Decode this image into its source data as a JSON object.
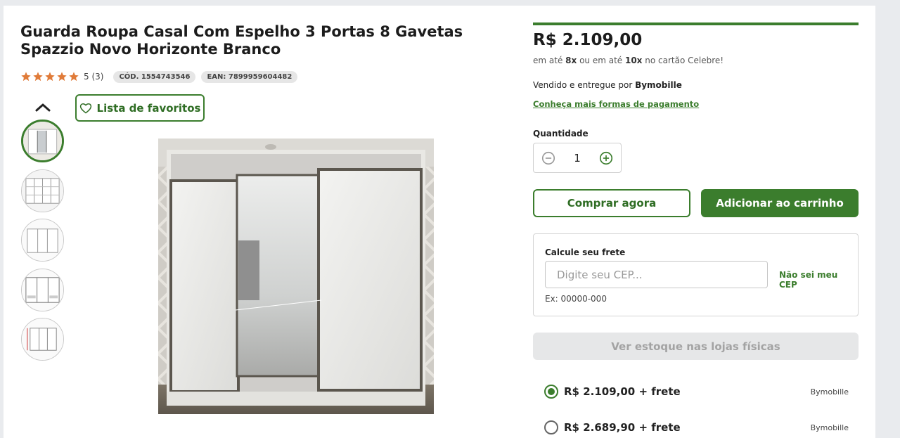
{
  "product": {
    "title": "Guarda Roupa Casal Com Espelho 3 Portas 8 Gavetas Spazzio Novo Horizonte Branco",
    "rating_text": "5 (3)",
    "rating_stars": 5,
    "code": "CÓD. 1554743546",
    "ean": "EAN: 7899959604482"
  },
  "gallery": {
    "favorites_label": "Lista de favoritos",
    "thumbnails": [
      "Foto 1",
      "Foto 2",
      "Foto 3",
      "Foto 4",
      "Foto 5"
    ],
    "selected_index": 0
  },
  "purchase": {
    "price": "R$ 2.109,00",
    "install_pre": "em até ",
    "install_n1": "8x",
    "install_mid": " ou em até ",
    "install_n2": "10x",
    "install_post": " no cartão Celebre!",
    "seller_pre": "Vendido e entregue por ",
    "seller_name": "Bymobille",
    "payment_link": "Conheça mais formas de pagamento",
    "quantity_label": "Quantidade",
    "quantity_value": "1",
    "buy_now": "Comprar agora",
    "add_to_cart": "Adicionar ao carrinho"
  },
  "shipping": {
    "title": "Calcule seu frete",
    "placeholder": "Digite seu CEP...",
    "no_cep_link": "Não sei meu CEP",
    "example": "Ex: 00000-000"
  },
  "stock_button": "Ver estoque nas lojas físicas",
  "offers": [
    {
      "price": "R$ 2.109,00 + frete",
      "seller": "Bymobille",
      "selected": true
    },
    {
      "price": "R$ 2.689,90 + frete",
      "seller": "Bymobille",
      "selected": false
    }
  ],
  "colors": {
    "accent": "#3b7d2d",
    "star": "#e07b39",
    "disabled_bg": "#e6e7e8"
  }
}
